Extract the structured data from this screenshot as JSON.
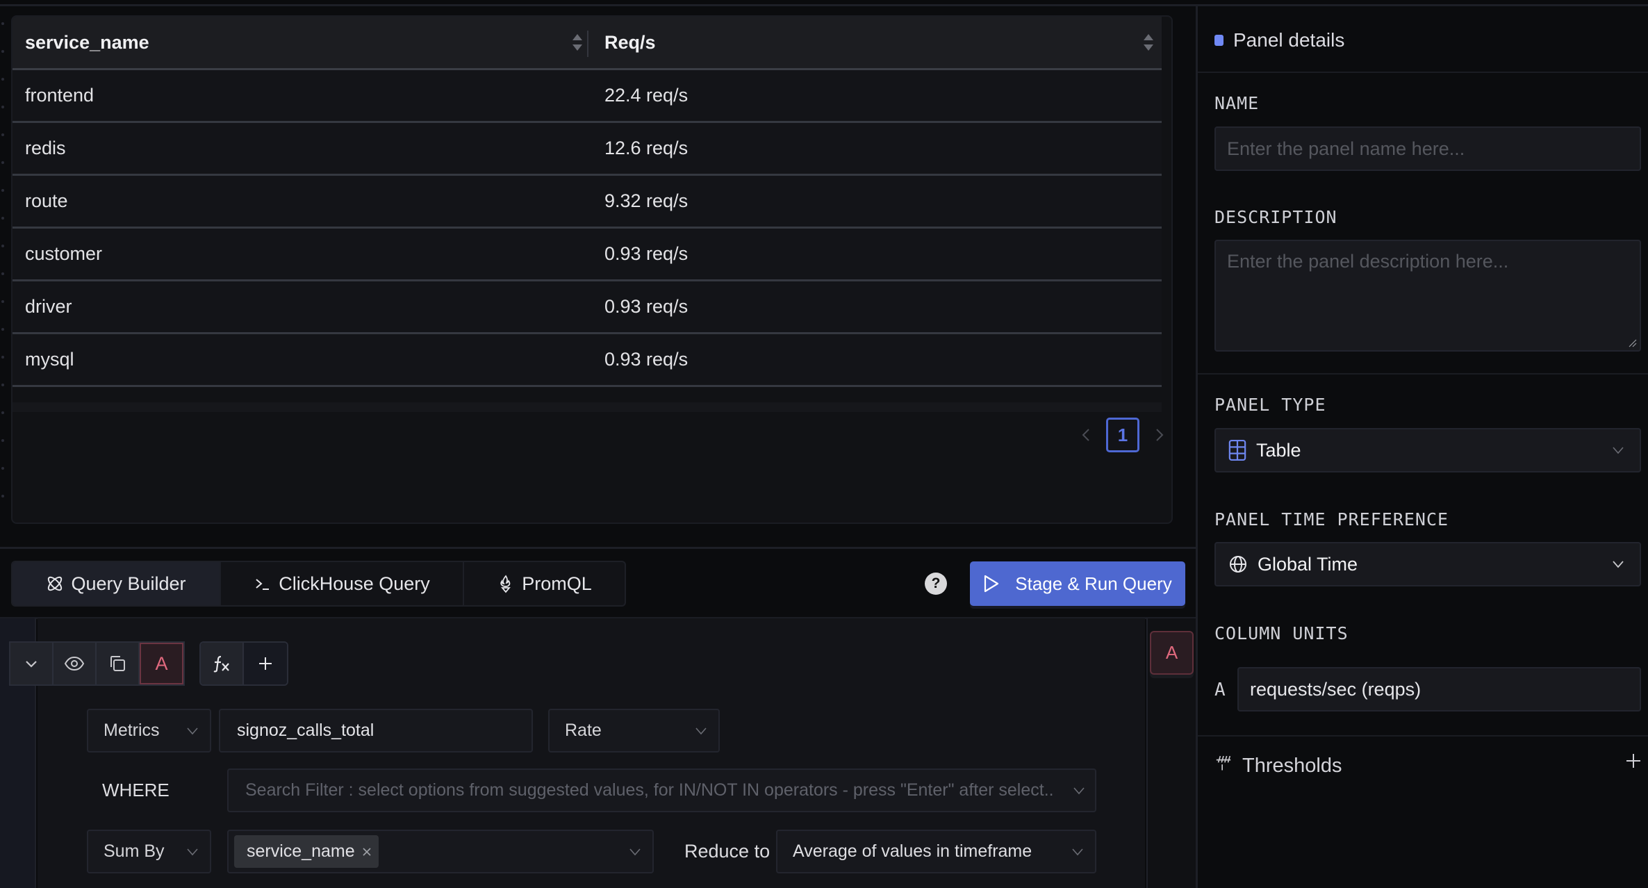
{
  "table": {
    "columns": [
      {
        "label": "service_name",
        "sortable": true
      },
      {
        "label": "Req/s",
        "sortable": true
      }
    ],
    "rows": [
      {
        "service_name": "frontend",
        "value": "22.4 req/s"
      },
      {
        "service_name": "redis",
        "value": "12.6 req/s"
      },
      {
        "service_name": "route",
        "value": "9.32 req/s"
      },
      {
        "service_name": "customer",
        "value": "0.93 req/s"
      },
      {
        "service_name": "driver",
        "value": "0.93 req/s"
      },
      {
        "service_name": "mysql",
        "value": "0.93 req/s"
      }
    ],
    "pagination": {
      "current_page": "1"
    }
  },
  "query_tabs": {
    "items": [
      {
        "label": "Query Builder",
        "icon": "atom-icon",
        "active": true
      },
      {
        "label": "ClickHouse Query",
        "icon": "terminal-icon",
        "active": false
      },
      {
        "label": "PromQL",
        "icon": "fire-icon",
        "active": false
      }
    ],
    "help_label": "?",
    "run_button_label": "Stage & Run Query"
  },
  "query": {
    "name": "A",
    "data_source": "Metrics",
    "metric_name": "signoz_calls_total",
    "aggregate": "Rate",
    "where_label": "WHERE",
    "where_placeholder": "Search Filter : select options from suggested values, for IN/NOT IN operators - press \"Enter\" after select..",
    "group_op": "Sum By",
    "group_by_tags": [
      "service_name"
    ],
    "reduce_label": "Reduce to",
    "reduce_value": "Average of values in timeframe",
    "formula_label": "ƒx",
    "add_label": "+"
  },
  "right_panel": {
    "title": "Panel details",
    "accent_color": "#7089f5",
    "name_label": "NAME",
    "name_placeholder": "Enter the panel name here...",
    "description_label": "DESCRIPTION",
    "description_placeholder": "Enter the panel description here...",
    "panel_type_label": "PANEL TYPE",
    "panel_type_value": "Table",
    "time_pref_label": "PANEL TIME PREFERENCE",
    "time_pref_value": "Global Time",
    "column_units_label": "COLUMN UNITS",
    "column_units": [
      {
        "query": "A",
        "unit": "requests/sec (reqps)"
      }
    ],
    "thresholds_label": "Thresholds"
  },
  "colors": {
    "primary": "#4e68d0",
    "query_accent": "#e0697e",
    "background": "#0b0c0e"
  }
}
